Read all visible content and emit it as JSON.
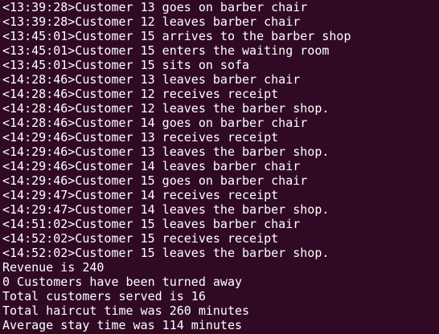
{
  "terminal": {
    "lines": [
      "<13:39:28>Customer 13 goes on barber chair",
      "<13:39:28>Customer 12 leaves barber chair",
      "<13:45:01>Customer 15 arrives to the barber shop",
      "<13:45:01>Customer 15 enters the waiting room",
      "<13:45:01>Customer 15 sits on sofa",
      "<14:28:46>Customer 13 leaves barber chair",
      "<14:28:46>Customer 12 receives receipt",
      "<14:28:46>Customer 12 leaves the barber shop.",
      "<14:28:46>Customer 14 goes on barber chair",
      "<14:29:46>Customer 13 receives receipt",
      "<14:29:46>Customer 13 leaves the barber shop.",
      "<14:29:46>Customer 14 leaves barber chair",
      "<14:29:46>Customer 15 goes on barber chair",
      "<14:29:47>Customer 14 receives receipt",
      "<14:29:47>Customer 14 leaves the barber shop.",
      "<14:51:02>Customer 15 leaves barber chair",
      "<14:52:02>Customer 15 receives receipt",
      "<14:52:02>Customer 15 leaves the barber shop.",
      "Revenue is 240",
      "0 Customers have been turned away",
      "Total customers served is 16",
      "Total haircut time was 260 minutes",
      "Average stay time was 114 minutes"
    ]
  },
  "colors": {
    "background": "#300a24",
    "text": "#ffffff"
  }
}
